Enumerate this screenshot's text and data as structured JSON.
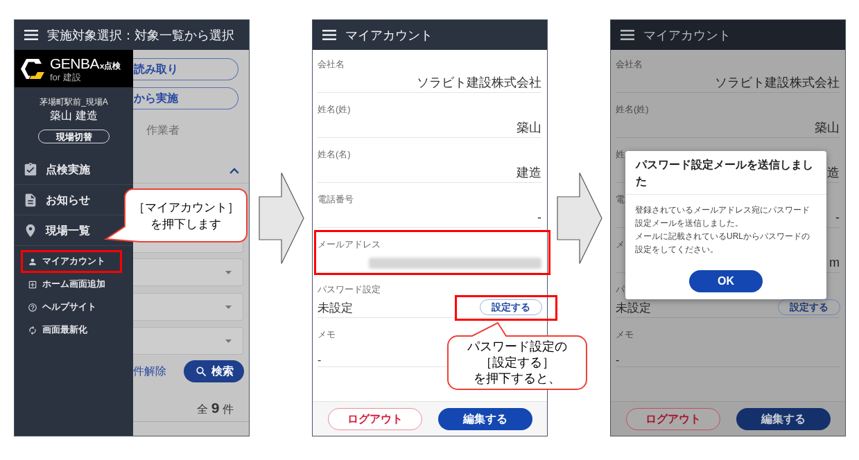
{
  "screens": [
    {
      "kind": "drawer_open",
      "header": {
        "title": "実施対象選択：対象一覧から選択"
      },
      "behind": {
        "buttons": [
          "読み取り",
          "から実施"
        ],
        "worker_label": "作業者",
        "clear_link": "件解除",
        "search_button": "検索",
        "total": "全 **9** 件"
      },
      "drawer": {
        "logo": {
          "brand": "GENBA",
          "suffix": "x点検",
          "tagline": "for 建設"
        },
        "site": "茅場町駅前_現場A",
        "user": "築山 建造",
        "switch_button": "現場切替",
        "primary_items": [
          "点検実施",
          "お知らせ",
          "現場一覧"
        ],
        "secondary_items": [
          {
            "label": "マイアカウント",
            "highlighted": true,
            "callout": [
              "［マイアカウント］",
              "を押下します"
            ]
          },
          {
            "label": "ホーム画面追加",
            "highlighted": false
          },
          {
            "label": "ヘルプサイト",
            "highlighted": false
          },
          {
            "label": "画面最新化",
            "highlighted": false
          }
        ]
      }
    },
    {
      "kind": "form",
      "header": {
        "title": "マイアカウント"
      },
      "fields": [
        {
          "kind": "text",
          "label": "会社名",
          "value": "ソラビト建設株式会社",
          "highlighted": false
        },
        {
          "kind": "text",
          "label": "姓名(姓)",
          "value": "築山",
          "highlighted": false
        },
        {
          "kind": "text",
          "label": "姓名(名)",
          "value": "建造",
          "highlighted": false
        },
        {
          "kind": "text",
          "label": "電話番号",
          "value": "-",
          "highlighted": false
        },
        {
          "kind": "redacted",
          "label": "メールアドレス",
          "highlighted": true
        },
        {
          "kind": "action",
          "label": "パスワード設定",
          "value": "未設定",
          "highlighted": false,
          "button": {
            "label": "設定する",
            "highlighted": true,
            "callout": [
              "パスワード設定の",
              "［設定する］",
              "を押下すると、"
            ]
          }
        },
        {
          "kind": "multiline",
          "label": "メモ",
          "value": "-",
          "highlighted": false
        }
      ],
      "footer": {
        "logout_button": "ログアウト",
        "edit_button": "編集する"
      }
    },
    {
      "kind": "form",
      "header": {
        "title": "マイアカウント"
      },
      "fields": [
        {
          "kind": "text",
          "label": "会社名",
          "value": "ソラビト建設株式会社",
          "highlighted": false
        },
        {
          "kind": "text",
          "label": "姓名(姓)",
          "value": "築山",
          "highlighted": false
        },
        {
          "kind": "text",
          "label": "姓",
          "value": "造",
          "highlighted": false
        },
        {
          "kind": "text",
          "label": "電",
          "value": "-",
          "highlighted": false
        },
        {
          "kind": "text",
          "label": "メ",
          "value": "m",
          "highlighted": false
        },
        {
          "kind": "action",
          "label": "パ",
          "value": "未設定",
          "highlighted": false,
          "button": {
            "label": "設定する",
            "highlighted": false
          }
        },
        {
          "kind": "multiline",
          "label": "メモ",
          "value": "-",
          "highlighted": false
        }
      ],
      "footer": {
        "logout_button": "ログアウト",
        "edit_button": "編集する"
      },
      "dialog": {
        "title": "パスワード設定メールを送信しました",
        "body": [
          "登録されているメールアドレス宛にパスワード設定メールを送信しました。",
          "メールに記載されているURLからパスワードの設定をしてください。"
        ],
        "button": "OK"
      }
    }
  ]
}
